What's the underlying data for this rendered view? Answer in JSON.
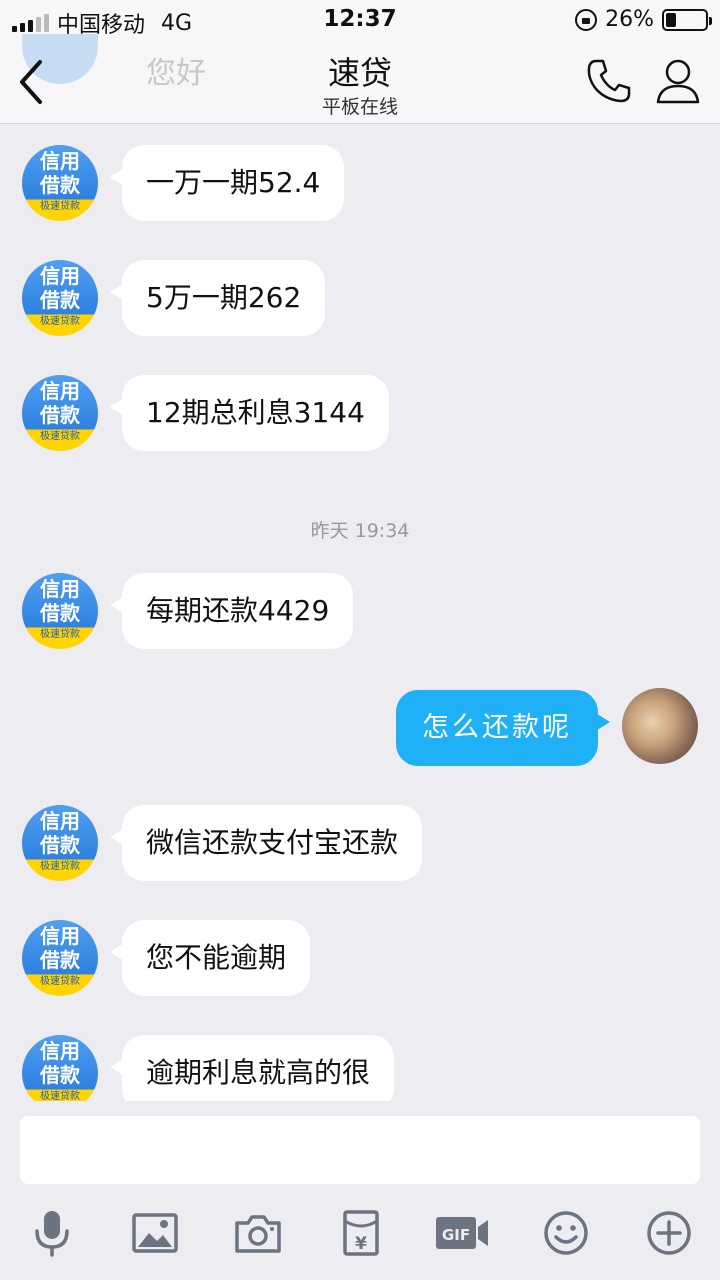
{
  "status_bar": {
    "carrier": "中国移动",
    "network": "4G",
    "time": "12:37",
    "battery_percent": "26%",
    "battery_level": 0.26
  },
  "nav": {
    "title": "速贷",
    "subtitle": "平板在线",
    "ghost_message": "您好"
  },
  "avatar_badge": {
    "line1": "信用",
    "line2": "借款",
    "line3": "极速贷款"
  },
  "messages": [
    {
      "side": "left",
      "text": "一万一期52.4"
    },
    {
      "side": "left",
      "text": "5万一期262"
    },
    {
      "side": "left",
      "text": "12期总利息3144"
    },
    {
      "side": "left",
      "text": "每期还款4429"
    },
    {
      "side": "right",
      "text": "怎么还款呢"
    },
    {
      "side": "left",
      "text": "微信还款支付宝还款"
    },
    {
      "side": "left",
      "text": "您不能逾期"
    },
    {
      "side": "left",
      "text": "逾期利息就高的很"
    }
  ],
  "timestamp": "昨天 19:34",
  "input": {
    "value": "",
    "placeholder": ""
  },
  "toolbar": [
    "microphone-icon",
    "image-icon",
    "camera-icon",
    "red-packet-icon",
    "gif-icon",
    "emoji-icon",
    "plus-icon"
  ],
  "colors": {
    "self_bubble": "#1fb0f5",
    "background": "#ececf1",
    "toolbar_icon": "#6b7480"
  }
}
